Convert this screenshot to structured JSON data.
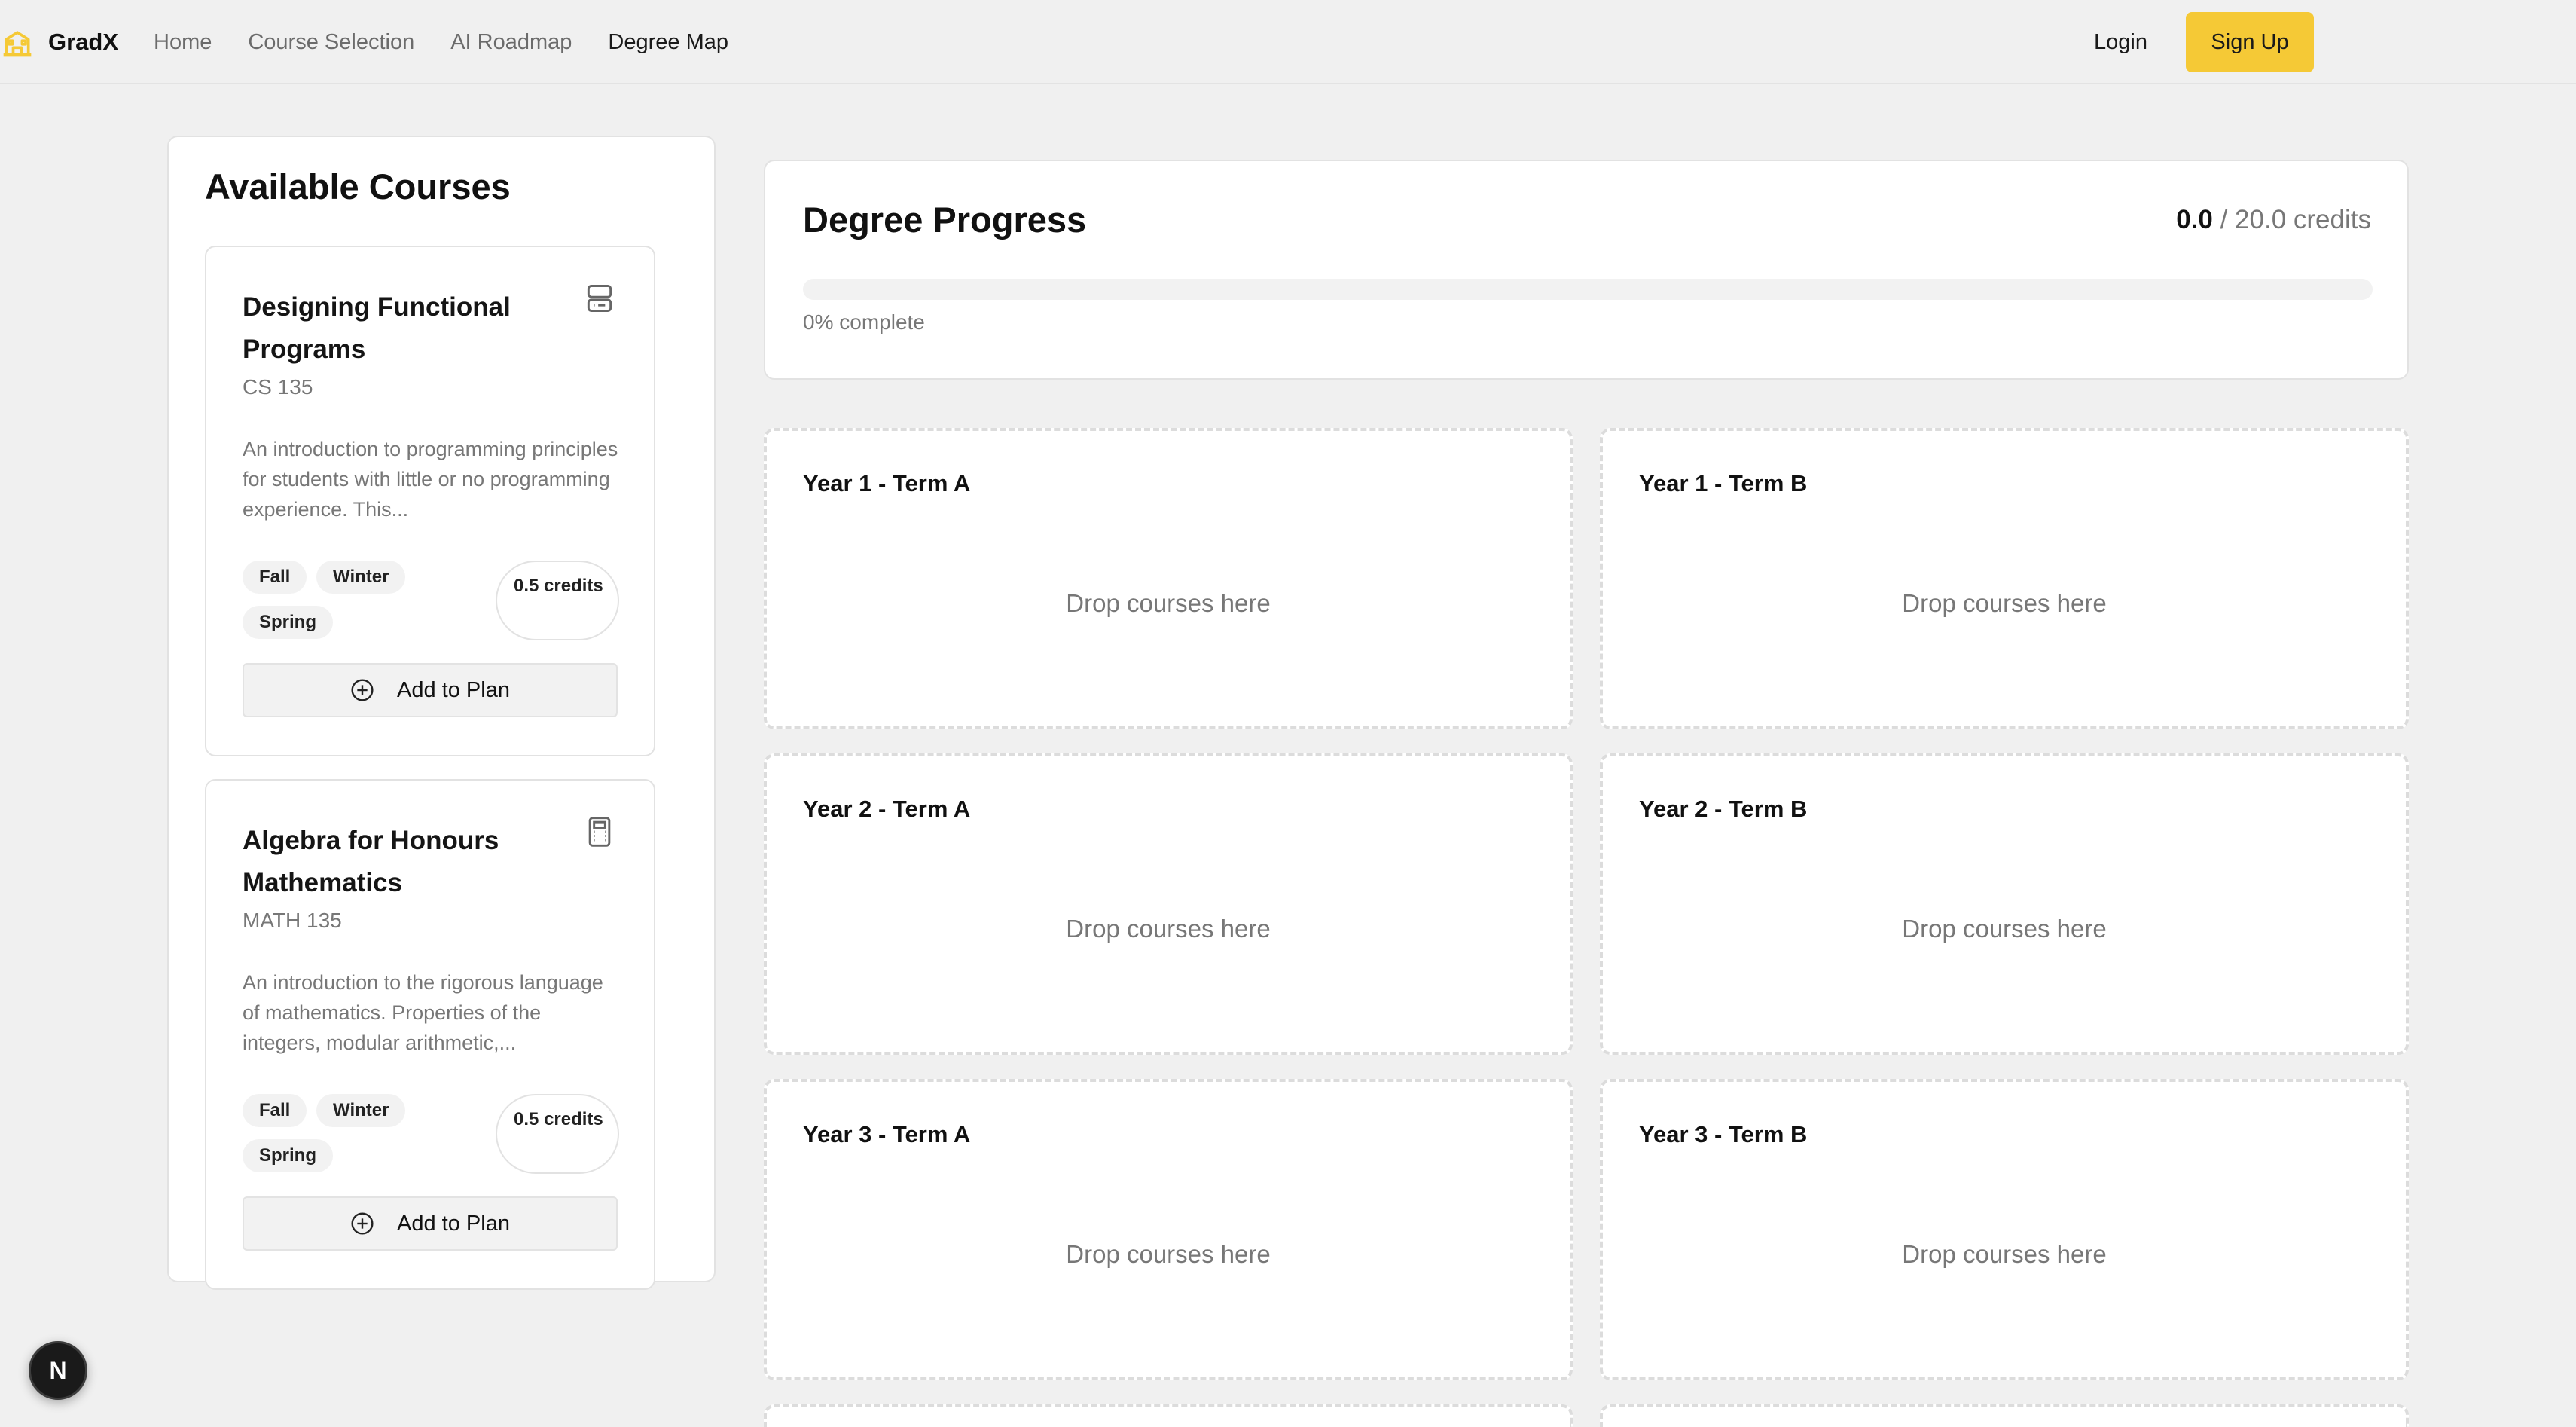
{
  "nav": {
    "brand": "GradX",
    "links": [
      "Home",
      "Course Selection",
      "AI Roadmap",
      "Degree Map"
    ],
    "active": "Degree Map",
    "login": "Login",
    "signup": "Sign Up"
  },
  "courses_panel": {
    "title": "Available Courses",
    "courses": [
      {
        "title": "Designing Functional Programs",
        "code": "CS 135",
        "icon": "server-icon",
        "description": "An introduction to programming principles for students with little or no programming experience. This...",
        "terms": [
          "Fall",
          "Winter",
          "Spring"
        ],
        "credits": "0.5 credits",
        "add_label": "Add to Plan"
      },
      {
        "title": "Algebra for Honours Mathematics",
        "code": "MATH 135",
        "icon": "calculator-icon",
        "description": "An introduction to the rigorous language of mathematics. Properties of the integers, modular arithmetic,...",
        "terms": [
          "Fall",
          "Winter",
          "Spring"
        ],
        "credits": "0.5 credits",
        "add_label": "Add to Plan"
      }
    ]
  },
  "progress": {
    "title": "Degree Progress",
    "completed": "0.0",
    "total_text": "/ 20.0 credits",
    "percent_label": "0% complete",
    "fraction": 0.0
  },
  "terms": [
    {
      "title": "Year 1 - Term A",
      "placeholder": "Drop courses here"
    },
    {
      "title": "Year 1 - Term B",
      "placeholder": "Drop courses here"
    },
    {
      "title": "Year 2 - Term A",
      "placeholder": "Drop courses here"
    },
    {
      "title": "Year 2 - Term B",
      "placeholder": "Drop courses here"
    },
    {
      "title": "Year 3 - Term A",
      "placeholder": "Drop courses here"
    },
    {
      "title": "Year 3 - Term B",
      "placeholder": "Drop courses here"
    }
  ],
  "badge": {
    "letter": "N"
  },
  "colors": {
    "accent": "#f5c936",
    "background": "#f0f0f0",
    "card": "#ffffff",
    "muted_text": "#777777"
  }
}
